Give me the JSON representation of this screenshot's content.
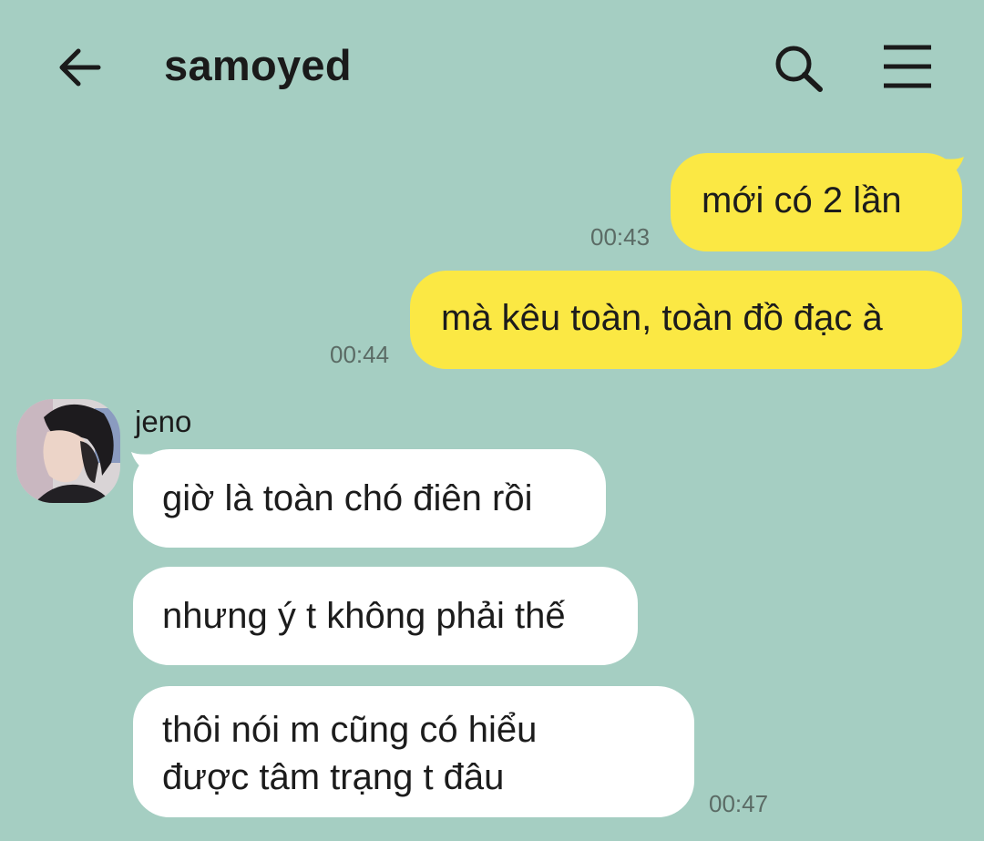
{
  "header": {
    "title": "samoyed"
  },
  "messages": [
    {
      "text": "mới có 2 lần",
      "time": "00:43"
    },
    {
      "text": "mà kêu toàn, toàn đồ đạc à",
      "time": "00:44"
    }
  ],
  "incoming": {
    "sender": "jeno",
    "messages": [
      {
        "text": "giờ là toàn chó điên rồi"
      },
      {
        "text": "nhưng ý t không phải thế"
      },
      {
        "line1": "thôi nói m cũng có hiểu",
        "line2": "được tâm trạng t đâu",
        "time": "00:47"
      }
    ]
  },
  "icons": [
    "back-arrow-icon",
    "search-icon",
    "menu-icon"
  ],
  "colors": {
    "background": "#a5cec2",
    "outgoing_bubble": "#fbe844",
    "incoming_bubble": "#ffffff"
  }
}
